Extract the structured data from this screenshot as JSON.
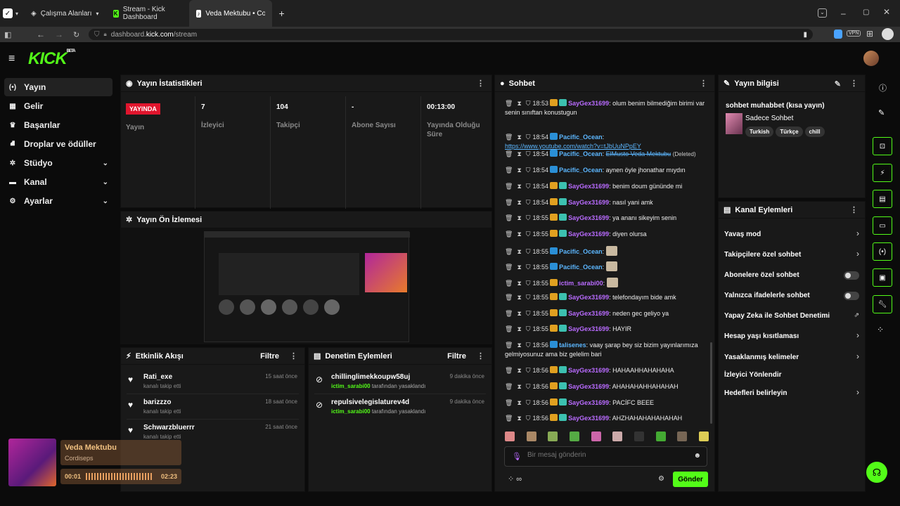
{
  "browser": {
    "tabs": [
      {
        "label": "Çalışma Alanları"
      },
      {
        "label": "Stream - Kick Dashboard"
      },
      {
        "label": "Veda Mektubu • Cordiseps"
      }
    ],
    "url_prefix": "dashboard.",
    "url_domain": "kick.com",
    "url_path": "/stream",
    "vpn_label": "VPN"
  },
  "brand": {
    "logo": "KICK",
    "beta": "BETA"
  },
  "sidebar": {
    "items": [
      {
        "label": "Yayın",
        "icon": "broadcast-icon"
      },
      {
        "label": "Gelir",
        "icon": "revenue-icon"
      },
      {
        "label": "Başarılar",
        "icon": "trophy-icon"
      },
      {
        "label": "Droplar ve ödüller",
        "icon": "drops-icon"
      },
      {
        "label": "Stüdyo",
        "icon": "studio-icon"
      },
      {
        "label": "Kanal",
        "icon": "channel-icon"
      },
      {
        "label": "Ayarlar",
        "icon": "gear-icon"
      }
    ]
  },
  "stats": {
    "title": "Yayın İstatistikleri",
    "live_badge": "YAYINDA",
    "items": [
      {
        "value": "",
        "label": "Yayın"
      },
      {
        "value": "7",
        "label": "İzleyici"
      },
      {
        "value": "104",
        "label": "Takipçi"
      },
      {
        "value": "-",
        "label": "Abone Sayısı"
      },
      {
        "value": "00:13:00",
        "label": "Yayında Olduğu Süre"
      }
    ]
  },
  "preview": {
    "title": "Yayın Ön İzlemesi"
  },
  "activity": {
    "title": "Etkinlik Akışı",
    "filter": "Filtre",
    "rows": [
      {
        "name": "Rati_exe",
        "sub": "kanalı takip etti",
        "time": "15 saat önce"
      },
      {
        "name": "barizzzo",
        "sub": "kanalı takip etti",
        "time": "18 saat önce"
      },
      {
        "name": "Schwarzbluerrr",
        "sub": "kanalı takip etti",
        "time": "21 saat önce"
      }
    ]
  },
  "moderation": {
    "title": "Denetim Eylemleri",
    "filter": "Filtre",
    "rows": [
      {
        "name": "chillinglimekkoupw58uj",
        "by": "ictim_sarabi00",
        "sub": "tarafından yasaklandı",
        "time": "9 dakika önce"
      },
      {
        "name": "repulsivelegislaturev4d",
        "by": "ictim_sarabi00",
        "sub": "tarafından yasaklandı",
        "time": "9 dakika önce"
      }
    ]
  },
  "chat": {
    "title": "Sohbet",
    "placeholder": "Bir mesaj gönderin",
    "send": "Gönder",
    "messages": [
      {
        "time": "18:53",
        "user": "SayGex31699",
        "color": "#b96bff",
        "text": ": olum benim bilmediğim birimi var senin sınıftan konustugun"
      },
      {
        "time": "18:54",
        "user": "Pacific_Ocean",
        "color": "#5cb7ff",
        "text": ":"
      },
      {
        "time": "18:54",
        "user": "Pacific_Ocean",
        "color": "#5cb7ff",
        "text": "ElMusto Veda Mektubu",
        "deleted": "(Deleted)"
      },
      {
        "time": "18:54",
        "user": "Pacific_Ocean",
        "color": "#5cb7ff",
        "text": ": aynen öyle jhonathar mıydın"
      },
      {
        "time": "18:54",
        "user": "SayGex31699",
        "color": "#b96bff",
        "text": ": benim doum gününde mi"
      },
      {
        "time": "18:54",
        "user": "SayGex31699",
        "color": "#b96bff",
        "text": ": nasıl yani amk"
      },
      {
        "time": "18:55",
        "user": "SayGex31699",
        "color": "#b96bff",
        "text": ": ya ananı sikeyim senin"
      },
      {
        "time": "18:55",
        "user": "SayGex31699",
        "color": "#b96bff",
        "text": ": diyen olursa"
      },
      {
        "time": "18:55",
        "user": "Pacific_Ocean",
        "color": "#5cb7ff",
        "text": ":"
      },
      {
        "time": "18:55",
        "user": "Pacific_Ocean",
        "color": "#5cb7ff",
        "text": ":"
      },
      {
        "time": "18:55",
        "user": "ictim_sarabi00",
        "color": "#b96bff",
        "text": ":"
      },
      {
        "time": "18:55",
        "user": "SayGex31699",
        "color": "#b96bff",
        "text": ": telefondayım bide amk"
      },
      {
        "time": "18:55",
        "user": "SayGex31699",
        "color": "#b96bff",
        "text": ": neden gec geliyo ya"
      },
      {
        "time": "18:55",
        "user": "SayGex31699",
        "color": "#b96bff",
        "text": ": HAYIR"
      },
      {
        "time": "18:56",
        "user": "talisenes",
        "color": "#5cb7ff",
        "text": ": vaay şarap bey siz bizim yayınlarımıza gelmiyosunuz ama biz gelelim bari"
      },
      {
        "time": "18:56",
        "user": "SayGex31699",
        "color": "#b96bff",
        "text": ": HAHAAHHAHAHAHA"
      },
      {
        "time": "18:56",
        "user": "SayGex31699",
        "color": "#b96bff",
        "text": ": AHAHAHAHHAHAHAH"
      },
      {
        "time": "18:56",
        "user": "SayGex31699",
        "color": "#b96bff",
        "text": ": PACİFC BEEE"
      },
      {
        "time": "18:56",
        "user": "SayGex31699",
        "color": "#b96bff",
        "text": ": AHZHAHAHAHAHAHAH"
      }
    ],
    "link": "https://www.youtube.com/watch?v=tJbUuNPpEY"
  },
  "stream_info": {
    "title": "Yayın bilgisi",
    "stream_title": "sohbet muhabbet (kısa yayın)",
    "category": "Sadece Sohbet",
    "tags": [
      "Turkish",
      "Türkçe",
      "chill"
    ]
  },
  "channel_actions": {
    "title": "Kanal Eylemleri",
    "items": [
      {
        "label": "Yavaş mod",
        "kind": "arrow"
      },
      {
        "label": "Takipçilere özel sohbet",
        "kind": "arrow"
      },
      {
        "label": "Abonelere özel sohbet",
        "kind": "toggle"
      },
      {
        "label": "Yalnızca ifadelerle sohbet",
        "kind": "toggle"
      },
      {
        "label": "Yapay Zeka ile Sohbet Denetimi",
        "kind": "ext"
      },
      {
        "label": "Hesap yaşı kısıtlaması",
        "kind": "arrow"
      },
      {
        "label": "Yasaklanmış kelimeler",
        "kind": "arrow"
      },
      {
        "label": "İzleyici Yönlendir",
        "kind": "none"
      },
      {
        "label": "Hedefleri belirleyin",
        "kind": "arrow"
      }
    ]
  },
  "player": {
    "song": "Veda Mektubu",
    "artist": "Cordiseps",
    "elapsed": "00:01",
    "total": "02:23"
  },
  "colors": {
    "accent": "#53fc18",
    "live": "#e0152d",
    "panel": "#191919"
  }
}
